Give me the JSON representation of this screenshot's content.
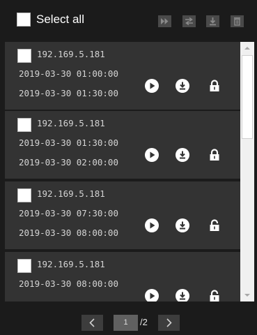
{
  "toolbar": {
    "select_all_label": "Select all",
    "icons": [
      "fast-forward-icon",
      "switch-icon",
      "download-icon",
      "delete-icon"
    ]
  },
  "records": [
    {
      "ip": "192.169.5.181",
      "start": "2019-03-30 01:00:00",
      "end": "2019-03-30 01:30:00",
      "lock": "locked"
    },
    {
      "ip": "192.169.5.181",
      "start": "2019-03-30 01:30:00",
      "end": "2019-03-30 02:00:00",
      "lock": "locked"
    },
    {
      "ip": "192.169.5.181",
      "start": "2019-03-30 07:30:00",
      "end": "2019-03-30 08:00:00",
      "lock": "unlocked"
    },
    {
      "ip": "192.169.5.181",
      "start": "2019-03-30 08:00:00",
      "end": "",
      "lock": "unlocked"
    }
  ],
  "pager": {
    "current_page": "1",
    "total": "/2"
  }
}
